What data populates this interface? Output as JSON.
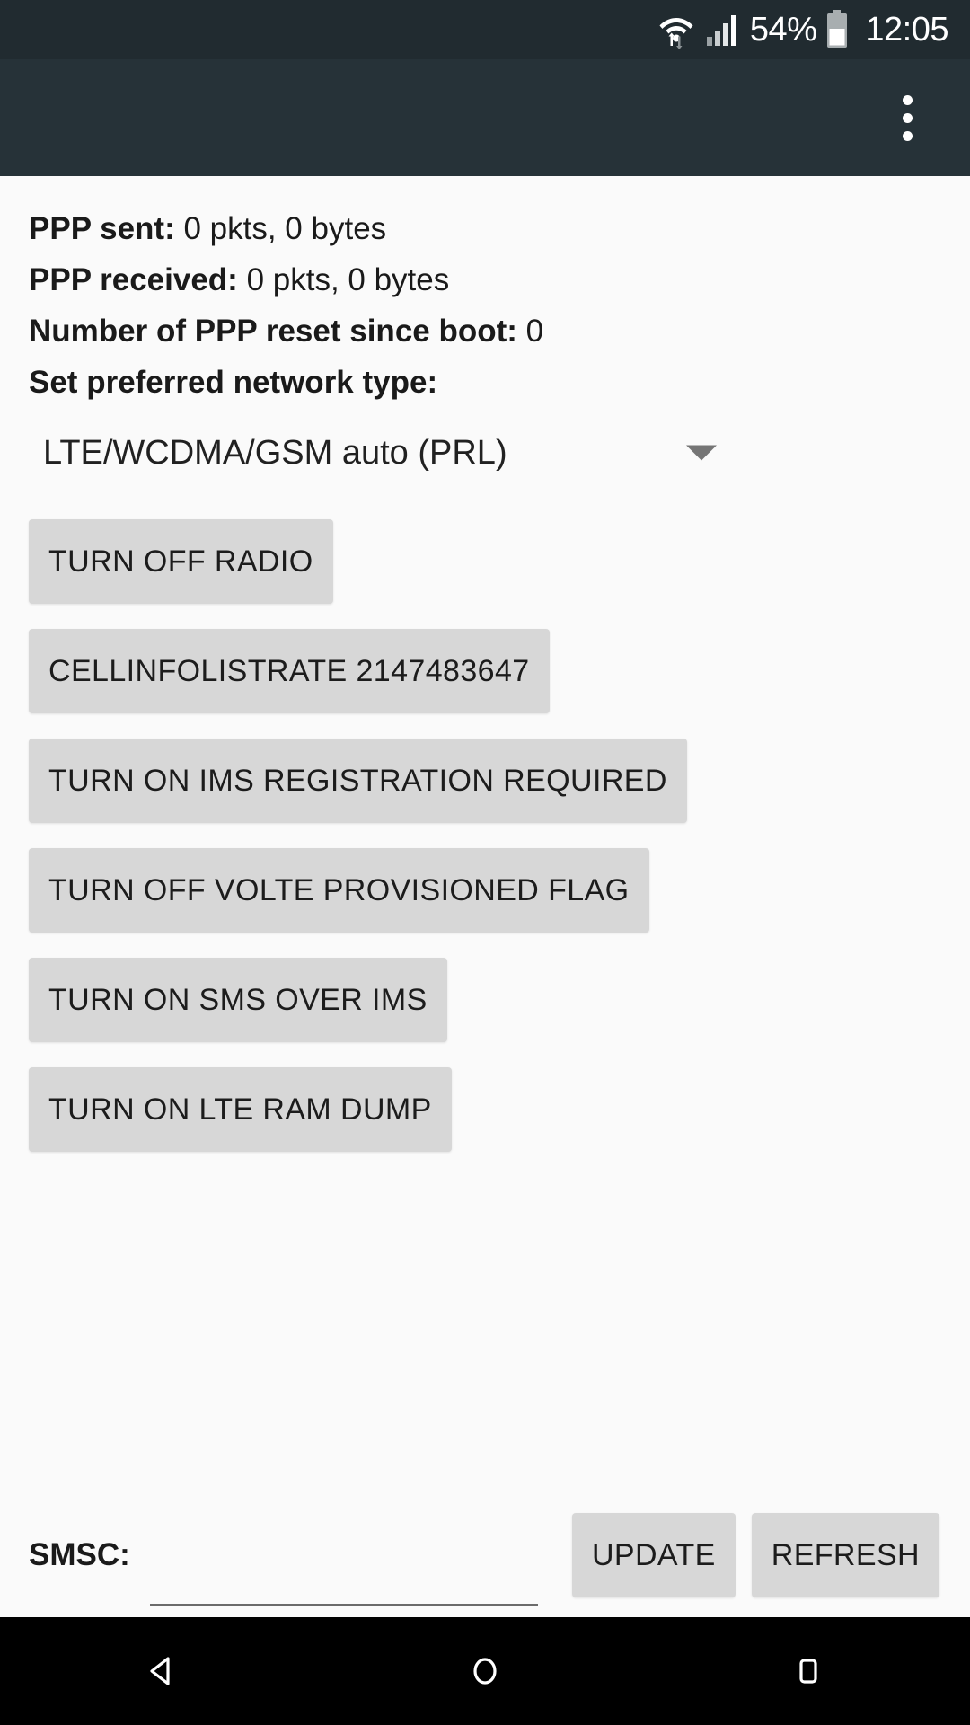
{
  "status_bar": {
    "wifi_icon": "wifi-with-activity-icon",
    "signal_icon": "cellular-signal-icon",
    "battery_percent": "54%",
    "battery_icon": "battery-icon",
    "clock": "12:05"
  },
  "app_bar": {
    "title": "",
    "overflow_icon": "overflow-menu-icon"
  },
  "info": [
    {
      "label": "PPP sent:",
      "value": "0 pkts, 0 bytes"
    },
    {
      "label": "PPP received:",
      "value": "0 pkts, 0 bytes"
    },
    {
      "label": "Number of PPP reset since boot:",
      "value": "0"
    },
    {
      "label": "Set preferred network type:",
      "value": ""
    }
  ],
  "spinner": {
    "selected": "LTE/WCDMA/GSM auto (PRL)",
    "arrow_icon": "chevron-down-icon"
  },
  "buttons": [
    {
      "label": "TURN OFF RADIO"
    },
    {
      "label": "CELLINFOLISTRATE 2147483647"
    },
    {
      "label": "TURN ON IMS REGISTRATION REQUIRED"
    },
    {
      "label": "TURN OFF VOLTE PROVISIONED FLAG"
    },
    {
      "label": "TURN ON SMS OVER IMS"
    },
    {
      "label": "TURN ON LTE RAM DUMP"
    }
  ],
  "smsc": {
    "label": "SMSC:",
    "value": "",
    "placeholder": "",
    "update_label": "UPDATE",
    "refresh_label": "REFRESH"
  },
  "nav_bar": {
    "back_icon": "back-triangle-icon",
    "home_icon": "home-circle-icon",
    "recents_icon": "recents-square-icon"
  },
  "colors": {
    "status_bar_bg": "#212b30",
    "app_bar_bg": "#263238",
    "content_bg": "#fafafa",
    "button_bg": "#d7d7d7",
    "nav_bar_bg": "#000000"
  }
}
